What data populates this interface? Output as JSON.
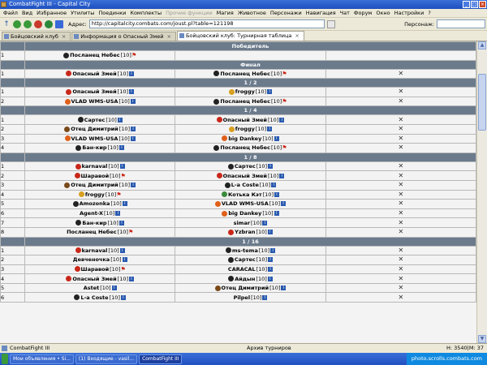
{
  "window": {
    "title": "CombatFight III - Capital City"
  },
  "menu": {
    "items": [
      "Файл",
      "Вид",
      "Избранное",
      "Утилиты",
      "Поединки",
      "Комплекты",
      "Прочие функции",
      "Магия",
      "Животное",
      "Персонажи",
      "Навигация",
      "Чат",
      "Форум",
      "Окно",
      "Настройки",
      "?"
    ]
  },
  "toolbar": {
    "address_label": "Адрес:",
    "address": "http://capitalcity.combats.com/joust.pl?table=121198",
    "persona_label": "Персонаж:"
  },
  "tabs": [
    {
      "label": "Бойцовский клуб"
    },
    {
      "label": "Информация о Опасный Змей"
    },
    {
      "label": "Бойцовский клуб: Турнирная таблица"
    }
  ],
  "tab_close": "×",
  "rounds": [
    {
      "title": "Победитель",
      "rows": [
        {
          "num": "1",
          "left": {
            "name": "Посланец Небес",
            "level": "[10]",
            "sign": "dark",
            "flag": true
          },
          "right": null,
          "action": false
        }
      ]
    },
    {
      "title": "Финал",
      "rows": [
        {
          "num": "1",
          "left": {
            "name": "Опасный Змей",
            "level": "[10]",
            "sign": "red",
            "info": true
          },
          "right": {
            "name": "Посланец Небес",
            "level": "[10]",
            "sign": "dark",
            "flag": true
          },
          "action": true
        }
      ]
    },
    {
      "title": "1 / 2",
      "rows": [
        {
          "num": "1",
          "left": {
            "name": "Опасный Змей",
            "level": "[10]",
            "sign": "red",
            "info": true
          },
          "right": {
            "name": "froggy",
            "level": "[10]",
            "sign": "gold",
            "info": true
          },
          "action": true
        },
        {
          "num": "2",
          "left": {
            "name": "VLAD WMS-USA",
            "level": "[10]",
            "sign": "orange",
            "info": true
          },
          "right": {
            "name": "Посланец Небес",
            "level": "[10]",
            "sign": "dark",
            "flag": true
          },
          "action": true
        }
      ]
    },
    {
      "title": "1 / 4",
      "rows": [
        {
          "num": "1",
          "left": {
            "name": "Сартес",
            "level": "[10]",
            "sign": "dark",
            "info": true
          },
          "right": {
            "name": "Опасный Змей",
            "level": "[10]",
            "sign": "red",
            "info": true
          },
          "action": true
        },
        {
          "num": "2",
          "left": {
            "name": "Отец Димитрий",
            "level": "[10]",
            "sign": "brown",
            "info": true
          },
          "right": {
            "name": "froggy",
            "level": "[10]",
            "sign": "gold",
            "info": true
          },
          "action": true
        },
        {
          "num": "3",
          "left": {
            "name": "VLAD WMS-USA",
            "level": "[10]",
            "sign": "orange",
            "info": true
          },
          "right": {
            "name": "big Dankey",
            "level": "[10]",
            "sign": "orange",
            "info": true
          },
          "action": true
        },
        {
          "num": "4",
          "left": {
            "name": "Бан-кир",
            "level": "[10]",
            "sign": "dark",
            "info": true
          },
          "right": {
            "name": "Посланец Небес",
            "level": "[10]",
            "sign": "dark",
            "flag": true
          },
          "action": true
        }
      ]
    },
    {
      "title": "1 / 8",
      "rows": [
        {
          "num": "1",
          "left": {
            "name": "karnaval",
            "level": "[10]",
            "sign": "red",
            "info": true
          },
          "right": {
            "name": "Сартес",
            "level": "[10]",
            "sign": "dark",
            "info": true
          },
          "action": true
        },
        {
          "num": "2",
          "left": {
            "name": "Шаравой",
            "level": "[10]",
            "sign": "red",
            "flag": true
          },
          "right": {
            "name": "Опасный Змей",
            "level": "[10]",
            "sign": "red",
            "info": true
          },
          "action": true
        },
        {
          "num": "3",
          "left": {
            "name": "Отец Димитрий",
            "level": "[10]",
            "sign": "brown",
            "info": true
          },
          "right": {
            "name": "L-a Coste",
            "level": "[10]",
            "sign": "dark",
            "info": true
          },
          "action": true
        },
        {
          "num": "4",
          "left": {
            "name": "froggy",
            "level": "[10]",
            "sign": "gold",
            "flag": true
          },
          "right": {
            "name": "Котька Кэт",
            "level": "[10]",
            "sign": "green",
            "info": true
          },
          "action": true
        },
        {
          "num": "5",
          "left": {
            "name": "Amozonka",
            "level": "[10]",
            "sign": "dark",
            "info": true
          },
          "right": {
            "name": "VLAD WMS-USA",
            "level": "[10]",
            "sign": "orange",
            "info": true
          },
          "action": true
        },
        {
          "num": "6",
          "left": {
            "name": "Agent-X",
            "level": "[10]",
            "sign": null,
            "info": true
          },
          "right": {
            "name": "big Dankey",
            "level": "[10]",
            "sign": "orange",
            "info": true
          },
          "action": true
        },
        {
          "num": "7",
          "left": {
            "name": "Бан-кир",
            "level": "[10]",
            "sign": "dark",
            "info": true
          },
          "right": {
            "name": "simar",
            "level": "[10]",
            "sign": null,
            "info": true
          },
          "action": true
        },
        {
          "num": "8",
          "left": {
            "name": "Посланец Небес",
            "level": "[10]",
            "sign": null,
            "flag": true
          },
          "right": {
            "name": "Yzbran",
            "level": "[10]",
            "sign": "red",
            "info": true
          },
          "action": true
        }
      ]
    },
    {
      "title": "1 / 16",
      "rows": [
        {
          "num": "1",
          "left": {
            "name": "karnaval",
            "level": "[10]",
            "sign": "red",
            "info": true
          },
          "right": {
            "name": "ms-tema",
            "level": "[10]",
            "sign": "dark",
            "info": true
          },
          "action": true
        },
        {
          "num": "2",
          "left": {
            "name": "Девченочка",
            "level": "[10]",
            "sign": null,
            "info": true
          },
          "right": {
            "name": "Сартес",
            "level": "[10]",
            "sign": "dark",
            "info": true
          },
          "action": true
        },
        {
          "num": "3",
          "left": {
            "name": "Шаравой",
            "level": "[10]",
            "sign": "red",
            "flag": true
          },
          "right": {
            "name": "CARACAL",
            "level": "[10]",
            "sign": null,
            "info": true
          },
          "action": true
        },
        {
          "num": "4",
          "left": {
            "name": "Опасный Змей",
            "level": "[10]",
            "sign": "red",
            "info": true
          },
          "right": {
            "name": "Айдын",
            "level": "[10]",
            "sign": "dark",
            "info": true
          },
          "action": true
        },
        {
          "num": "5",
          "left": {
            "name": "Astet",
            "level": "[10]",
            "sign": null,
            "info": true
          },
          "right": {
            "name": "Отец Димитрий",
            "level": "[10]",
            "sign": "brown",
            "info": true
          },
          "action": true
        },
        {
          "num": "6",
          "left": {
            "name": "L-a Coste",
            "level": "[10]",
            "sign": "dark",
            "info": true
          },
          "right": {
            "name": "Pilpel",
            "level": "[10]",
            "sign": null,
            "info": true
          },
          "action": true
        }
      ]
    }
  ],
  "statusbar": {
    "left": "CombatFight III",
    "mid": "Архив турниров",
    "right": "Н: 3540|М: 37"
  },
  "taskbar": {
    "tasks": [
      "Мои объявления • Si...",
      "(1) Входящие - vasil...",
      "CombatFight III"
    ],
    "tray": "photo.scrolls.combats.com"
  },
  "colors": {
    "header_bg": "#6b7b8c",
    "titlebar": "#2a5ad0",
    "cell_bg": "#f3f3f3"
  }
}
